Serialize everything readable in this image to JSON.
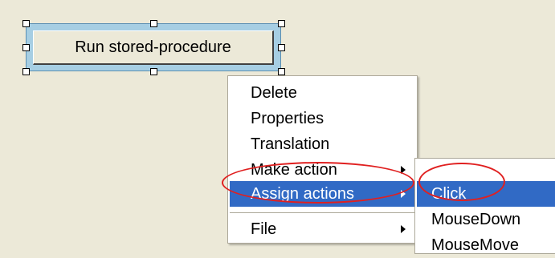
{
  "design_surface": {
    "button_label": "Run stored-procedure"
  },
  "context_menu": {
    "items": [
      {
        "label": "Delete"
      },
      {
        "label": "Properties"
      },
      {
        "label": "Translation"
      },
      {
        "label": "Make action",
        "has_submenu": true
      },
      {
        "label": "Assign actions",
        "has_submenu": true,
        "highlighted": true
      },
      {
        "label": "File",
        "has_submenu": true
      }
    ]
  },
  "submenu": {
    "items": [
      {
        "label": "Click",
        "highlighted": true
      },
      {
        "label": "MouseDown"
      },
      {
        "label": "MouseMove"
      }
    ]
  },
  "colors": {
    "background": "#ece9d8",
    "selection": "#a6cee3",
    "menu_highlight": "#316ac5",
    "annotation": "#e02020"
  }
}
